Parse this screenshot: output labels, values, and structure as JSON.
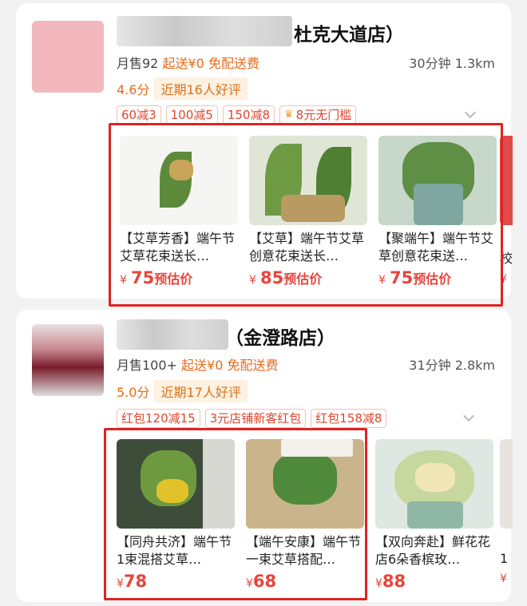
{
  "stores": [
    {
      "name": "杜克大道店）",
      "monthly_sales": "月售92",
      "min_order": "起送¥0",
      "delivery": "免配送费",
      "time_distance": "30分钟 1.3km",
      "score": "4.6分",
      "reviews": "近期16人好评",
      "tags": [
        "60减3",
        "100减5",
        "150减8",
        "8元无门槛"
      ],
      "products": [
        {
          "title": "【艾草芳香】端午节艾草花束送长…",
          "yen": "¥",
          "price": "75",
          "suffix": "预估价"
        },
        {
          "title": "【艾草】端午节艾草创意花束送长…",
          "yen": "¥",
          "price": "85",
          "suffix": "预估价"
        },
        {
          "title": "【聚端午】端午节艾草创意花束送…",
          "yen": "¥",
          "price": "75",
          "suffix": "预估价"
        }
      ],
      "peek_title": "校",
      "peek_yen": "¥"
    },
    {
      "name": "（金澄路店）",
      "monthly_sales": "月售100+",
      "min_order": "起送¥0",
      "delivery": "免配送费",
      "time_distance": "31分钟 2.8km",
      "score": "5.0分",
      "reviews": "近期17人好评",
      "tags": [
        "红包120减15",
        "3元店铺新客红包",
        "红包158减8"
      ],
      "products": [
        {
          "title": "【同舟共济】端午节1束混搭艾草…",
          "yen": "¥",
          "price": "78",
          "suffix": ""
        },
        {
          "title": "【端午安康】端午节一束艾草搭配…",
          "yen": "¥",
          "price": "68",
          "suffix": ""
        },
        {
          "title": "【双向奔赴】鲜花花店6朵香槟玫…",
          "yen": "¥",
          "price": "88",
          "suffix": ""
        }
      ],
      "peek_title": "1",
      "peek_yen": "¥"
    }
  ],
  "colors": {
    "accent": "#e96a1a",
    "price": "#e8443a",
    "highlight_box": "#e02222"
  },
  "icons": {
    "crown": "crown-icon",
    "expand": "chevron-down-icon"
  }
}
